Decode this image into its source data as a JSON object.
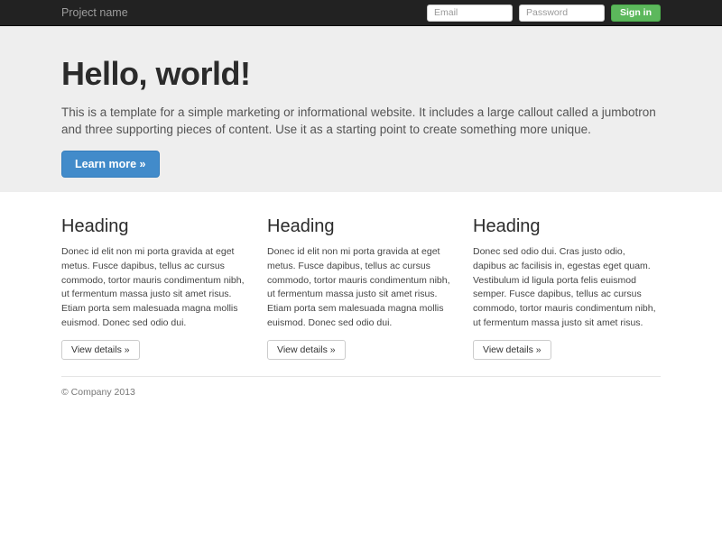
{
  "navbar": {
    "brand": "Project name",
    "email_placeholder": "Email",
    "password_placeholder": "Password",
    "signin_label": "Sign in"
  },
  "jumbotron": {
    "title": "Hello, world!",
    "description": "This is a template for a simple marketing or informational website. It includes a large callout called a jumbotron and three supporting pieces of content. Use it as a starting point to create something more unique.",
    "cta_label": "Learn more »"
  },
  "columns": [
    {
      "heading": "Heading",
      "text": "Donec id elit non mi porta gravida at eget metus. Fusce dapibus, tellus ac cursus commodo, tortor mauris condimentum nibh, ut fermentum massa justo sit amet risus. Etiam porta sem malesuada magna mollis euismod. Donec sed odio dui.",
      "button_label": "View details »"
    },
    {
      "heading": "Heading",
      "text": "Donec id elit non mi porta gravida at eget metus. Fusce dapibus, tellus ac cursus commodo, tortor mauris condimentum nibh, ut fermentum massa justo sit amet risus. Etiam porta sem malesuada magna mollis euismod. Donec sed odio dui.",
      "button_label": "View details »"
    },
    {
      "heading": "Heading",
      "text": "Donec sed odio dui. Cras justo odio, dapibus ac facilisis in, egestas eget quam. Vestibulum id ligula porta felis euismod semper. Fusce dapibus, tellus ac cursus commodo, tortor mauris condimentum nibh, ut fermentum massa justo sit amet risus.",
      "button_label": "View details »"
    }
  ],
  "footer": {
    "copyright": "© Company 2013"
  },
  "colors": {
    "navbar_bg": "#222222",
    "jumbotron_bg": "#eeeeee",
    "primary_blue": "#428bca",
    "success_green": "#5cb85c"
  }
}
